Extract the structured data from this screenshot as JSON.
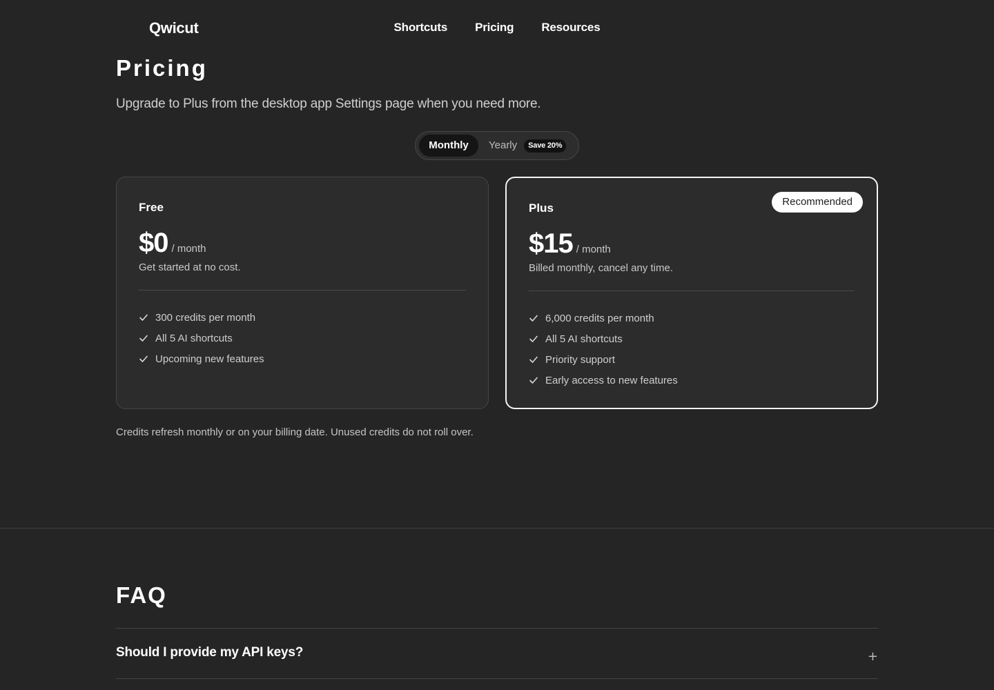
{
  "nav": {
    "logo": "Qwicut",
    "links": [
      "Shortcuts",
      "Pricing",
      "Resources"
    ]
  },
  "pricing": {
    "title": "Pricing",
    "subtitle": "Upgrade to Plus from the desktop app Settings page when you need more.",
    "toggle": {
      "monthly": "Monthly",
      "yearly": "Yearly",
      "save_badge": "Save 20%",
      "selected": "Monthly"
    },
    "plans": [
      {
        "name": "Free",
        "price": "$0",
        "period": "/ month",
        "description": "Get started at no cost.",
        "features": [
          "300 credits per month",
          "All 5 AI shortcuts",
          "Upcoming new features"
        ]
      },
      {
        "name": "Plus",
        "price": "$15",
        "period": "/ month",
        "description": "Billed monthly, cancel any time.",
        "badge": "Recommended",
        "features": [
          "6,000 credits per month",
          "All 5 AI shortcuts",
          "Priority support",
          "Early access to new features"
        ]
      }
    ],
    "note": "Credits refresh monthly or on your billing date. Unused credits do not roll over."
  },
  "faq": {
    "title": "FAQ",
    "items": [
      {
        "question": "Should I provide my API keys?",
        "toggle": "+"
      }
    ]
  },
  "colors": {
    "background": "#252525",
    "card": "#2c2c2c",
    "accent": "#ffffff"
  }
}
